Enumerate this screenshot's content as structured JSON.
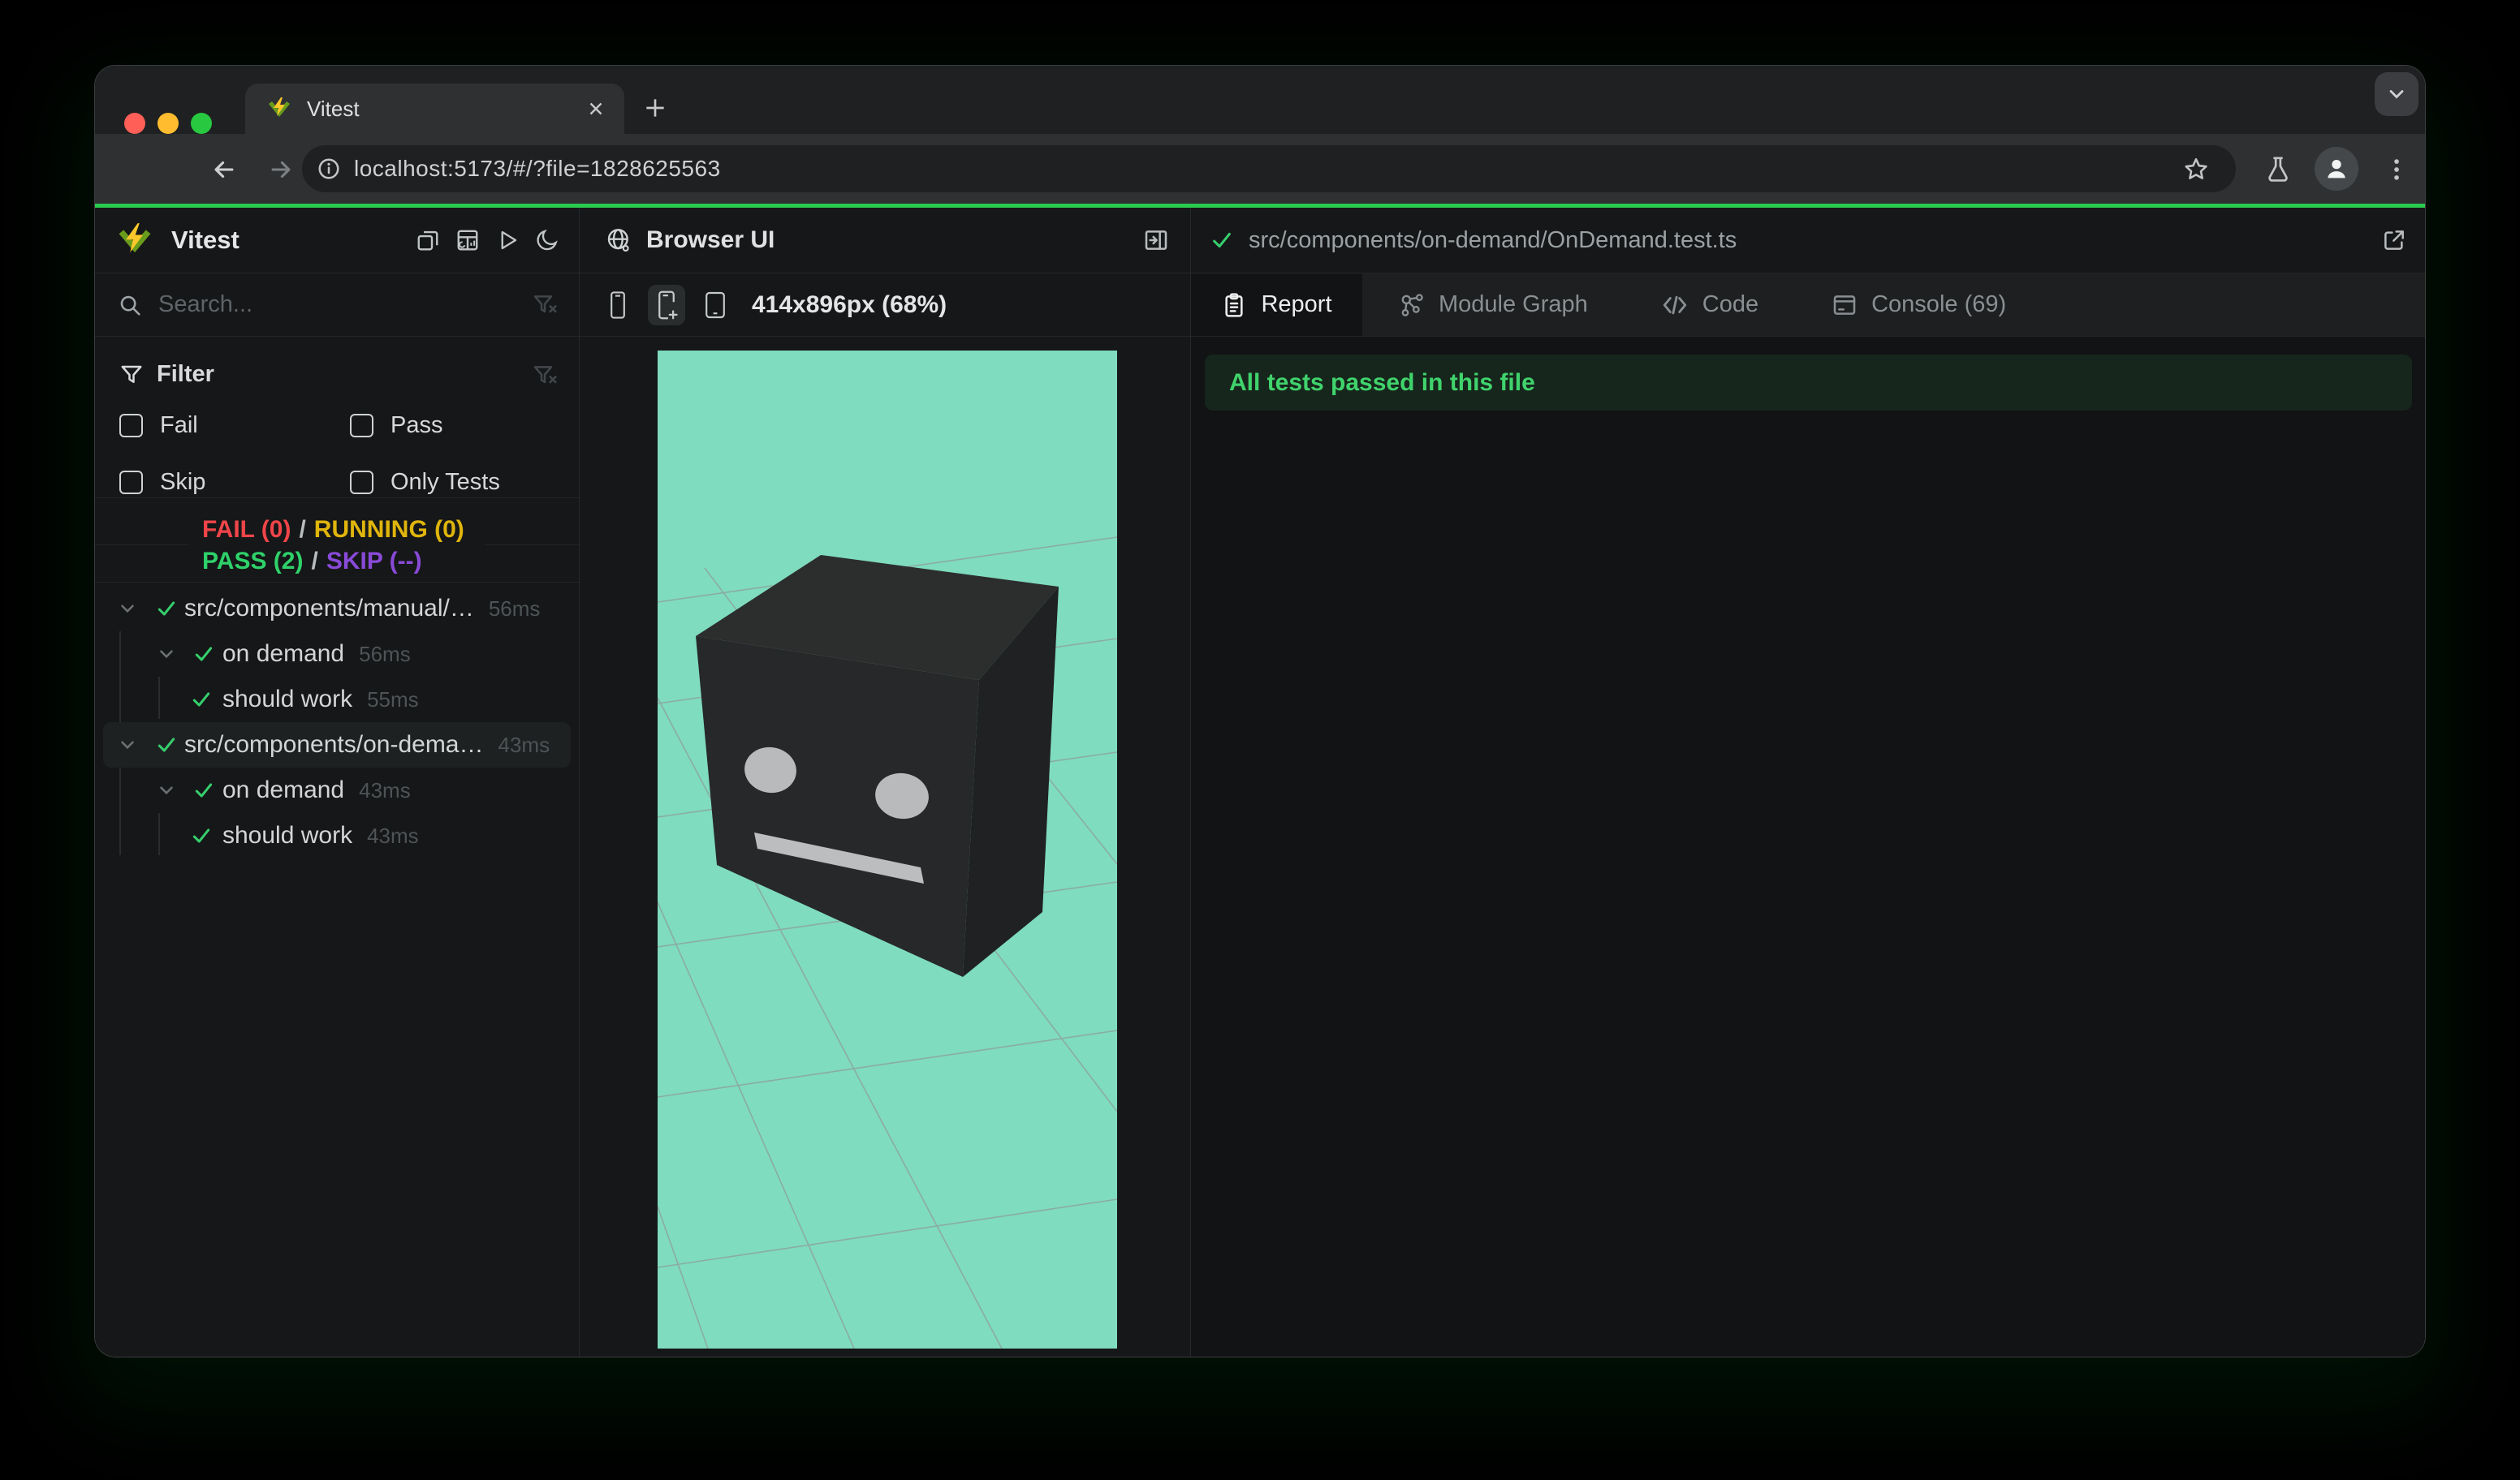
{
  "browser": {
    "tab_title": "Vitest",
    "url": "localhost:5173/#/?file=1828625563",
    "traffic": {
      "close": "#ff5f57",
      "minimize": "#febc2e",
      "zoom": "#28c840"
    }
  },
  "sidebar": {
    "app_title": "Vitest",
    "search_placeholder": "Search...",
    "filter": {
      "title": "Filter",
      "options": [
        {
          "label": "Fail",
          "checked": false
        },
        {
          "label": "Pass",
          "checked": false
        },
        {
          "label": "Skip",
          "checked": false
        },
        {
          "label": "Only Tests",
          "checked": false
        }
      ]
    },
    "stats": {
      "fail": "FAIL (0)",
      "running": "RUNNING (0)",
      "pass": "PASS (2)",
      "skip": "SKIP (--)",
      "sep": "/"
    },
    "tree": [
      {
        "type": "file",
        "label": "src/components/manual/…",
        "duration": "56ms",
        "selected": false
      },
      {
        "type": "suite",
        "label": "on demand",
        "duration": "56ms",
        "selected": false
      },
      {
        "type": "test",
        "label": "should work",
        "duration": "55ms",
        "selected": false
      },
      {
        "type": "file",
        "label": "src/components/on-dema…",
        "duration": "43ms",
        "selected": true
      },
      {
        "type": "suite",
        "label": "on demand",
        "duration": "43ms",
        "selected": false
      },
      {
        "type": "test",
        "label": "should work",
        "duration": "43ms",
        "selected": false
      }
    ]
  },
  "preview": {
    "panel_title": "Browser UI",
    "size_label": "414x896px (68%)"
  },
  "report": {
    "file_path": "src/components/on-demand/OnDemand.test.ts",
    "tabs": {
      "report": "Report",
      "module_graph": "Module Graph",
      "code": "Code",
      "console": "Console (69)"
    },
    "banner": "All tests passed in this file"
  },
  "icons": [
    "vitest-logo",
    "search",
    "filter-funnel",
    "filter-clear",
    "windows-stack",
    "dashboard",
    "run-play",
    "moon",
    "globe",
    "panel-open",
    "phone",
    "phone-plus",
    "tablet",
    "check",
    "chevron-down",
    "external-link",
    "report-clipboard",
    "module-graph",
    "code-brackets",
    "console-terminal",
    "back-arrow",
    "forward-arrow",
    "reload",
    "info",
    "star",
    "flask",
    "profile",
    "kebab-menu",
    "plus",
    "close-x"
  ],
  "colors": {
    "accent_green": "#2bcb4e",
    "fail": "#ef4549",
    "running": "#e0b50c",
    "pass": "#2fd26a",
    "skip": "#8a4ad8",
    "check_green": "#36cf6d",
    "mint_background": "#7fdcbe",
    "banner_text": "#40d36c"
  }
}
